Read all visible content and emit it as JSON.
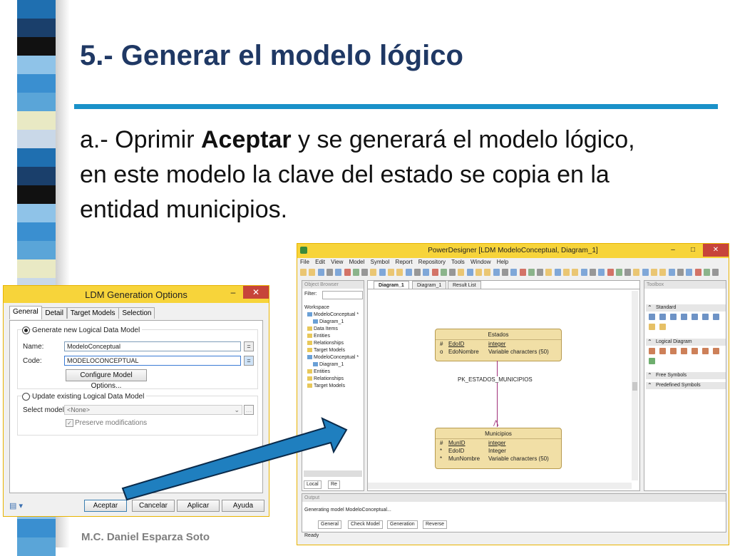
{
  "slide": {
    "title": "5.- Generar el modelo lógico",
    "text_prefix": "a.- Oprimir ",
    "text_bold": "Aceptar",
    "text_suffix": " y se generará el modelo lógico, en este modelo la clave del estado se copia en la entidad municipios.",
    "footer": "M.C. Daniel Esparza Soto"
  },
  "colors": {
    "title": "#1f3864",
    "rule": "#1a91c9",
    "window_title": "#f7d43a",
    "entity_fill": "#f1dfa6",
    "arrow": "#1f7fbf"
  },
  "dialog": {
    "title": "LDM Generation Options",
    "tabs": [
      "General",
      "Detail",
      "Target Models",
      "Selection"
    ],
    "generate_new_label": "Generate new Logical Data Model",
    "name_label": "Name:",
    "name_value": "ModeloConceptual",
    "code_label": "Code:",
    "code_value": "MODELOCONCEPTUAL",
    "eq_label": "=",
    "configure_button": "Configure Model Options...",
    "update_label": "Update existing Logical Data Model",
    "select_model_label": "Select model:",
    "select_model_value": "<None>",
    "preserve_label": "Preserve modifications",
    "buttons": {
      "accept": "Aceptar",
      "cancel": "Cancelar",
      "apply": "Aplicar",
      "help": "Ayuda"
    }
  },
  "pd": {
    "title": "PowerDesigner [LDM ModeloConceptual, Diagram_1]",
    "menu": [
      "File",
      "Edit",
      "View",
      "Model",
      "Symbol",
      "Report",
      "Repository",
      "Tools",
      "Window",
      "Help"
    ],
    "browser": {
      "header": "Object Browser",
      "filter_label": "Filter:",
      "tree": [
        "Workspace",
        "ModeloConceptual *",
        "Diagram_1",
        "Data Items",
        "Entities",
        "Relationships",
        "Target Models",
        "ModeloConceptual *",
        "Diagram_1",
        "Entities",
        "Relationships",
        "Target Models"
      ],
      "tab_local": "Local",
      "tab_re": "Re"
    },
    "diagram_tabs": [
      "Diagram_1",
      "Diagram_1",
      "Result List"
    ],
    "entity_estados": {
      "name": "Estados",
      "rows": [
        {
          "mark": "#",
          "attr": "EdoID",
          "type": "integer"
        },
        {
          "mark": "o",
          "attr": "EdoNombre",
          "type": "Variable characters (50)"
        }
      ]
    },
    "relationship_label": "PK_ESTADOS_MUNICIPIOS",
    "entity_municipios": {
      "name": "Municipios",
      "rows": [
        {
          "mark": "#",
          "attr": "MunID",
          "type": "integer"
        },
        {
          "mark": "*",
          "attr": "EdoID",
          "type": "Integer"
        },
        {
          "mark": "*",
          "attr": "MunNombre",
          "type": "Variable characters (50)"
        }
      ]
    },
    "toolbox": {
      "header": "Toolbox",
      "sections": [
        "Standard",
        "Logical Diagram",
        "Free Symbols",
        "Predefined Symbols"
      ]
    },
    "output": {
      "header": "Output",
      "text": "Generating model ModeloConceptual...",
      "tabs": [
        "General",
        "Check Model",
        "Generation",
        "Reverse"
      ]
    },
    "status": "Ready"
  }
}
